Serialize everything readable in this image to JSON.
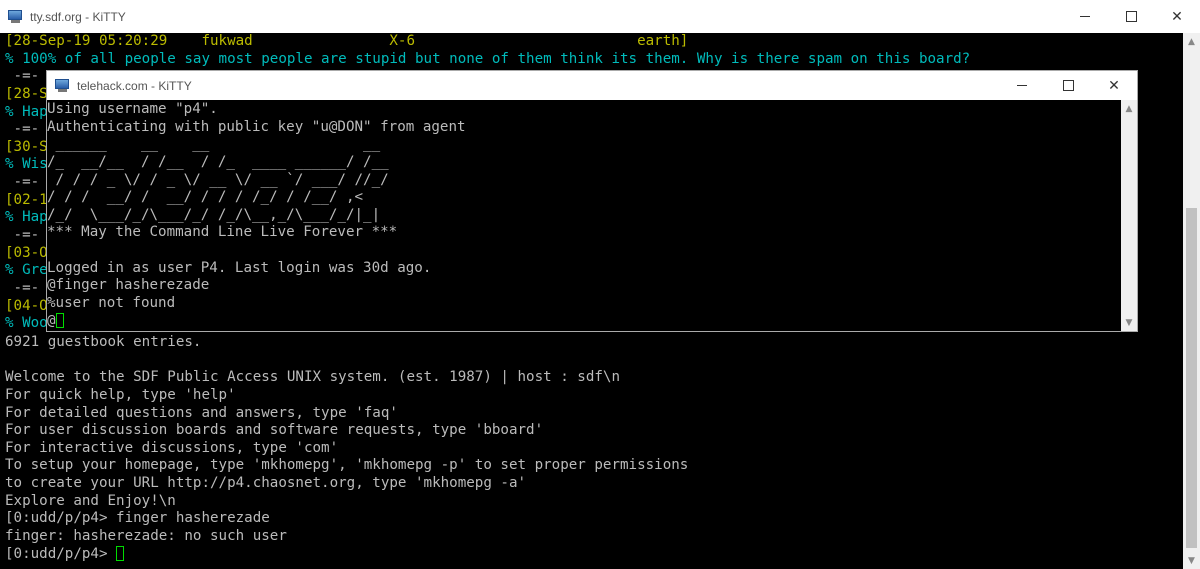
{
  "back_window": {
    "title": "tty.sdf.org - KiTTY",
    "visible_lines_top": [
      {
        "text": "[28-Sep-19 05:20:29    fukwad                X-6                          earth]",
        "color": "c-yellow"
      },
      {
        "text": "% 100% of all people say most people are stupid but none of them think its them. Why is there spam on this board?",
        "color": "c-cyan"
      },
      {
        "text": " -=-",
        "color": "c-white"
      },
      {
        "text": "[28-S",
        "color": "c-yellow"
      },
      {
        "text": "% Hap",
        "color": "c-cyan"
      },
      {
        "text": " -=-",
        "color": "c-white"
      },
      {
        "text": "[30-S",
        "color": "c-yellow"
      },
      {
        "text": "% Wis",
        "color": "c-cyan"
      },
      {
        "text": " -=-",
        "color": "c-white"
      },
      {
        "text": "[02-1",
        "color": "c-yellow"
      },
      {
        "text": "% Hap",
        "color": "c-cyan"
      },
      {
        "text": " -=-",
        "color": "c-white"
      },
      {
        "text": "[03-O",
        "color": "c-yellow"
      },
      {
        "text": "% Gre",
        "color": "c-cyan"
      },
      {
        "text": " -=-",
        "color": "c-white"
      },
      {
        "text": "[04-O",
        "color": "c-yellow"
      },
      {
        "text": "% Woo",
        "color": "c-cyan"
      }
    ],
    "lines_bottom": [
      "6921 guestbook entries.",
      "",
      "Welcome to the SDF Public Access UNIX system. (est. 1987) | host : sdf\\n",
      "For quick help, type 'help'",
      "For detailed questions and answers, type 'faq'",
      "For user discussion boards and software requests, type 'bboard'",
      "For interactive discussions, type 'com'",
      "To setup your homepage, type 'mkhomepg', 'mkhomepg -p' to set proper permissions",
      "to create your URL http://p4.chaosnet.org, type 'mkhomepg -a'",
      "Explore and Enjoy!\\n",
      "[0:udd/p/p4> finger hasherezade",
      "finger: hasherezade: no such user"
    ],
    "prompt": "[0:udd/p/p4> "
  },
  "front_window": {
    "title": "telehack.com - KiTTY",
    "lines": [
      "Using username \"p4\".",
      "Authenticating with public key \"u@DON\" from agent",
      " ______    __    __                  __",
      "/_  __/__  / /__  / /_  ____ ______/ /__",
      " / / / _ \\/ / _ \\/ __ \\/ __ `/ ___/ //_/",
      "/ / /  __/ /  __/ / / / /_/ / /__/ ,<",
      "/_/  \\___/_/\\___/_/ /_/\\__,_/\\___/_/|_|",
      "*** May the Command Line Live Forever ***",
      "",
      "Logged in as user P4. Last login was 30d ago.",
      "@finger hasherezade",
      "%user not found"
    ],
    "prompt": "@"
  },
  "icons": {
    "app_icon": "kitty-terminal-icon",
    "minimize": "minimize-icon",
    "maximize": "maximize-icon",
    "close": "close-icon"
  },
  "colors": {
    "terminal_bg": "#000000",
    "terminal_text": "#bbbbbb",
    "cyan": "#00bbbb",
    "yellow": "#bbbb00",
    "cursor": "#00dd00"
  }
}
